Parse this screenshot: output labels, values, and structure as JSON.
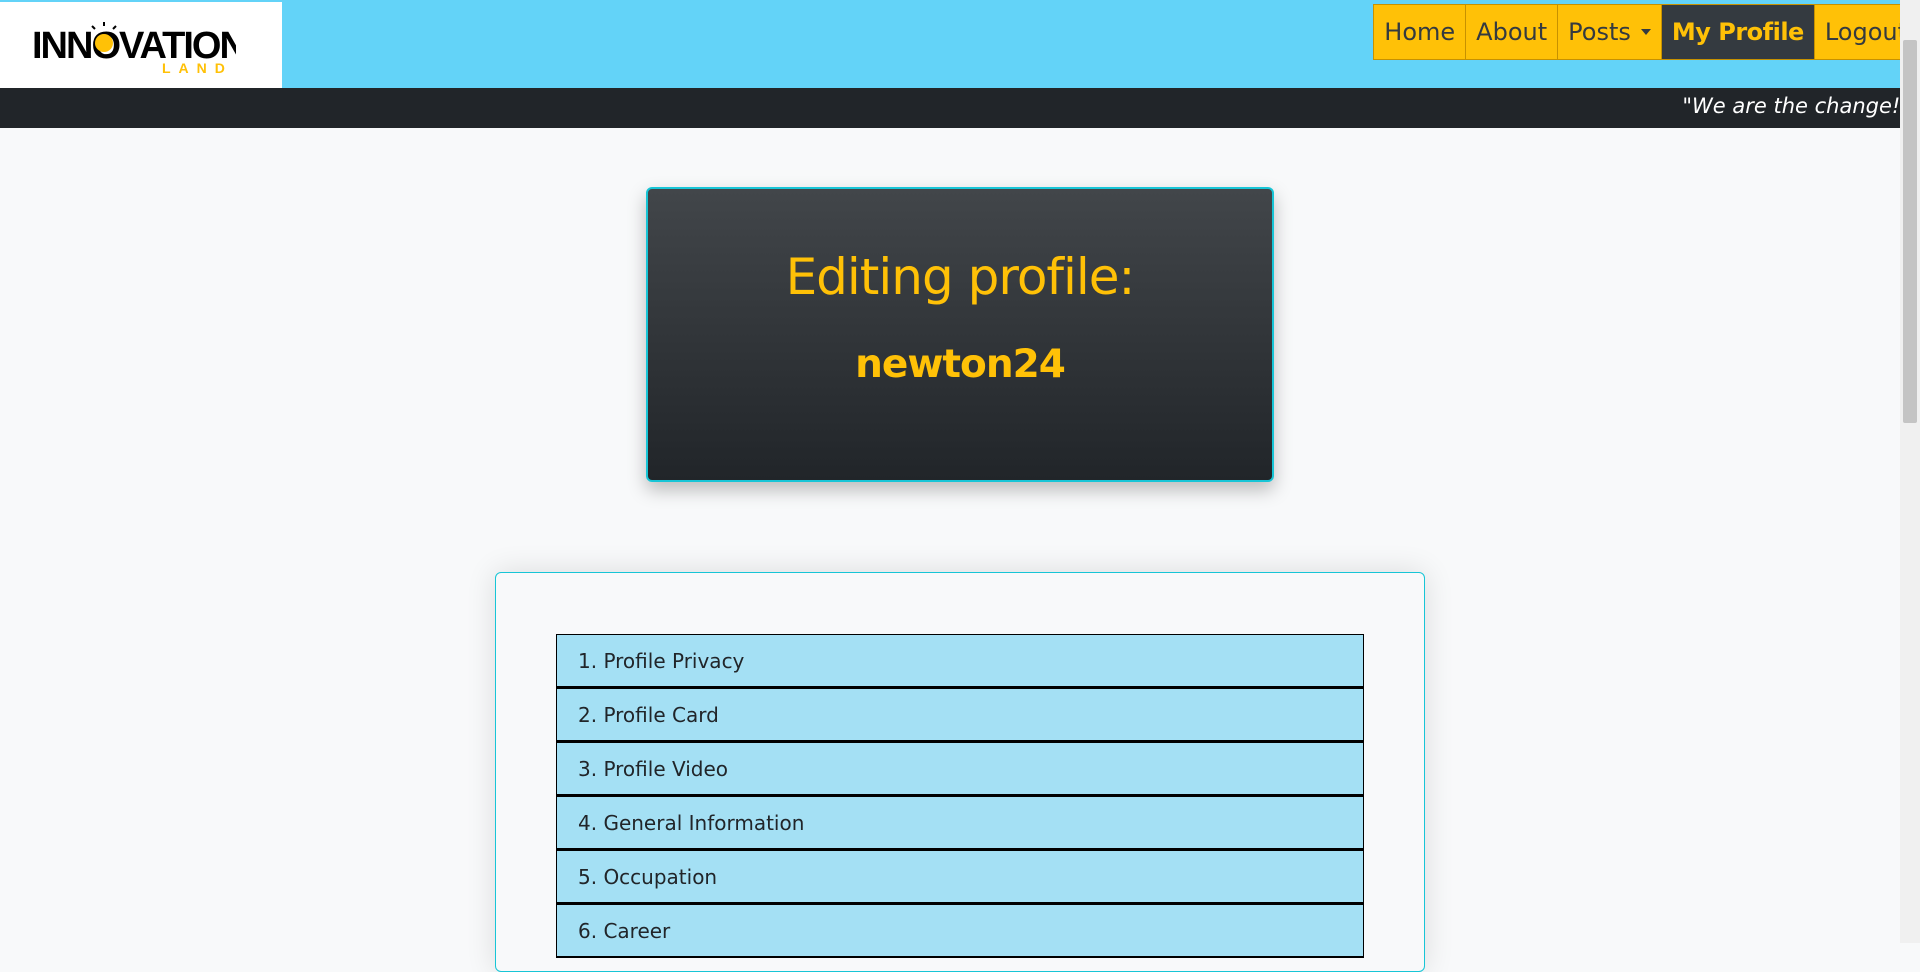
{
  "header": {
    "logo_text": "INNOVATION",
    "logo_subtext": "LAND",
    "nav": [
      {
        "label": "Home"
      },
      {
        "label": "About"
      },
      {
        "label": "Posts"
      },
      {
        "label": "My Profile"
      },
      {
        "label": "Logout"
      }
    ],
    "tagline": "\"We are the change!\""
  },
  "hero": {
    "title": "Editing profile:",
    "username": "newton24"
  },
  "sections": [
    {
      "label": "1. Profile Privacy"
    },
    {
      "label": "2. Profile Card"
    },
    {
      "label": "3. Profile Video"
    },
    {
      "label": "4. General Information"
    },
    {
      "label": "5. Occupation"
    },
    {
      "label": "6. Career"
    }
  ],
  "colors": {
    "accent": "#ffc107",
    "navbar": "#63d3f8",
    "dark": "#212529",
    "section_bg": "#a4e0f4",
    "border_teal": "#17c5d6"
  }
}
